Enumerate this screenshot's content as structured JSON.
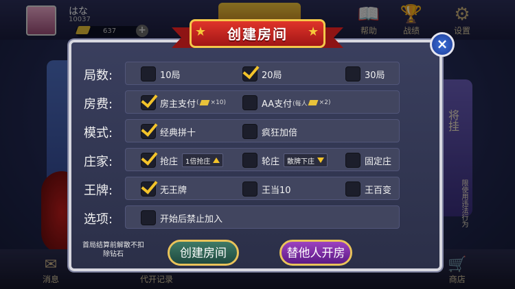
{
  "lobby": {
    "nickname": "はな",
    "user_id": "10037",
    "diamonds": "637",
    "plus": "+",
    "nav": [
      {
        "label": "帮助",
        "icon": "book-icon"
      },
      {
        "label": "战绩",
        "icon": "trophy-icon"
      },
      {
        "label": "设置",
        "icon": "gear-icon"
      }
    ],
    "bottom_nav": [
      {
        "label": "消息",
        "icon": "mail-icon"
      },
      {
        "label": "代开记录",
        "icon": ""
      },
      {
        "label": "商店",
        "icon": "cart-icon"
      }
    ],
    "side_text": "将挂",
    "side_text_small": "限使用违法行为"
  },
  "dialog": {
    "title": "创建房间",
    "close": "×",
    "rows": [
      {
        "label": "局数:",
        "options": [
          {
            "text": "10局",
            "checked": false
          },
          {
            "text": "20局",
            "checked": true
          },
          {
            "text": "30局",
            "checked": false
          }
        ]
      },
      {
        "label": "房费:",
        "options": [
          {
            "text": "房主支付",
            "sub": "(",
            "sub2": "×10)",
            "checked": true
          },
          {
            "text": "AA支付",
            "sub": "(每人",
            "sub2": "×2)",
            "checked": false
          }
        ]
      },
      {
        "label": "模式:",
        "options": [
          {
            "text": "经典拼十",
            "checked": true
          },
          {
            "text": "疯狂加倍",
            "checked": false
          }
        ]
      },
      {
        "label": "庄家:",
        "options": [
          {
            "text": "抢庄",
            "dropdown": "1倍抢庄",
            "checked": true
          },
          {
            "text": "轮庄",
            "dropdown": "散牌下庄",
            "checked": false
          },
          {
            "text": "固定庄",
            "checked": false
          }
        ]
      },
      {
        "label": "王牌:",
        "options": [
          {
            "text": "无王牌",
            "checked": true
          },
          {
            "text": "王当10",
            "checked": false
          },
          {
            "text": "王百变",
            "checked": false
          }
        ]
      },
      {
        "label": "选项:",
        "options": [
          {
            "text": "开始后禁止加入",
            "checked": false
          }
        ]
      }
    ],
    "note": "首局结算前解散不扣除钻石",
    "create_button": "创建房间",
    "proxy_button": "替他人开房"
  },
  "colors": {
    "accent_gold": "#f3c32a",
    "ribbon_red": "#c22420",
    "create_green": "#2f6454",
    "proxy_purple": "#7a2ea6",
    "close_blue": "#2a55c0"
  }
}
